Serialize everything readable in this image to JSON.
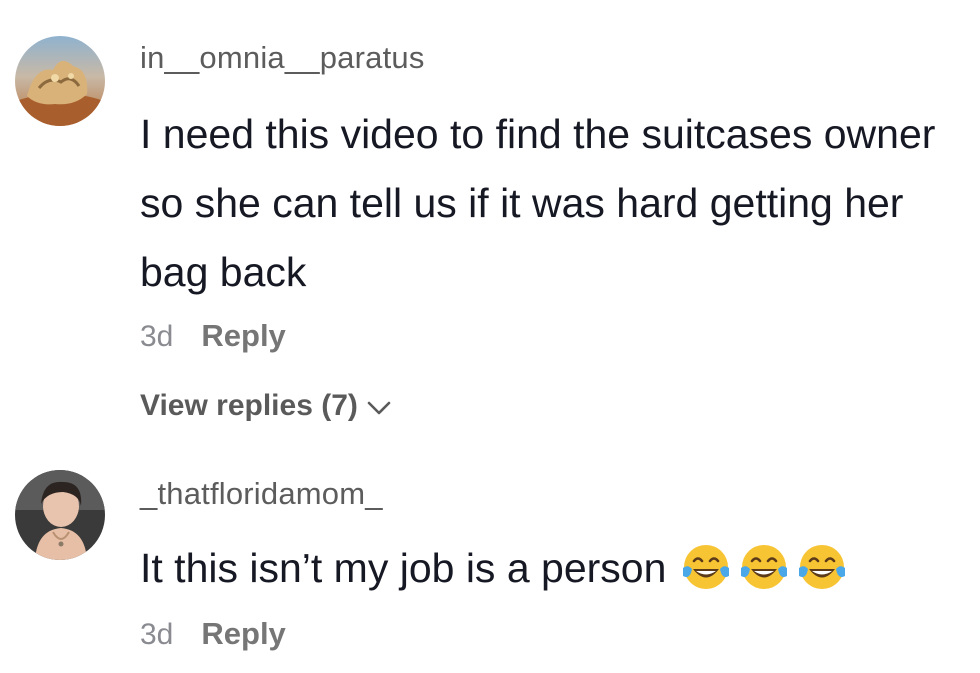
{
  "comments": [
    {
      "username": "in__omnia__paratus",
      "text": "I need this video to find the suitcases owner so she can tell us if it was hard getting her bag back",
      "time": "3d",
      "reply_label": "Reply",
      "view_replies_label": "View replies (7)",
      "avatar_icon": "desert-rock-avatar"
    },
    {
      "username": "_thatfloridamom_",
      "text": "It this isn’t my job is a person",
      "emojis": [
        "face-with-tears-of-joy",
        "face-with-tears-of-joy",
        "face-with-tears-of-joy"
      ],
      "time": "3d",
      "reply_label": "Reply",
      "avatar_icon": "woman-selfie-avatar"
    }
  ],
  "colors": {
    "username": "#5c5c5c",
    "body": "#161823",
    "meta": "#8a8b91",
    "reply": "#767676",
    "emoji_face": "#f7c433",
    "emoji_tears": "#4aa8e8"
  }
}
